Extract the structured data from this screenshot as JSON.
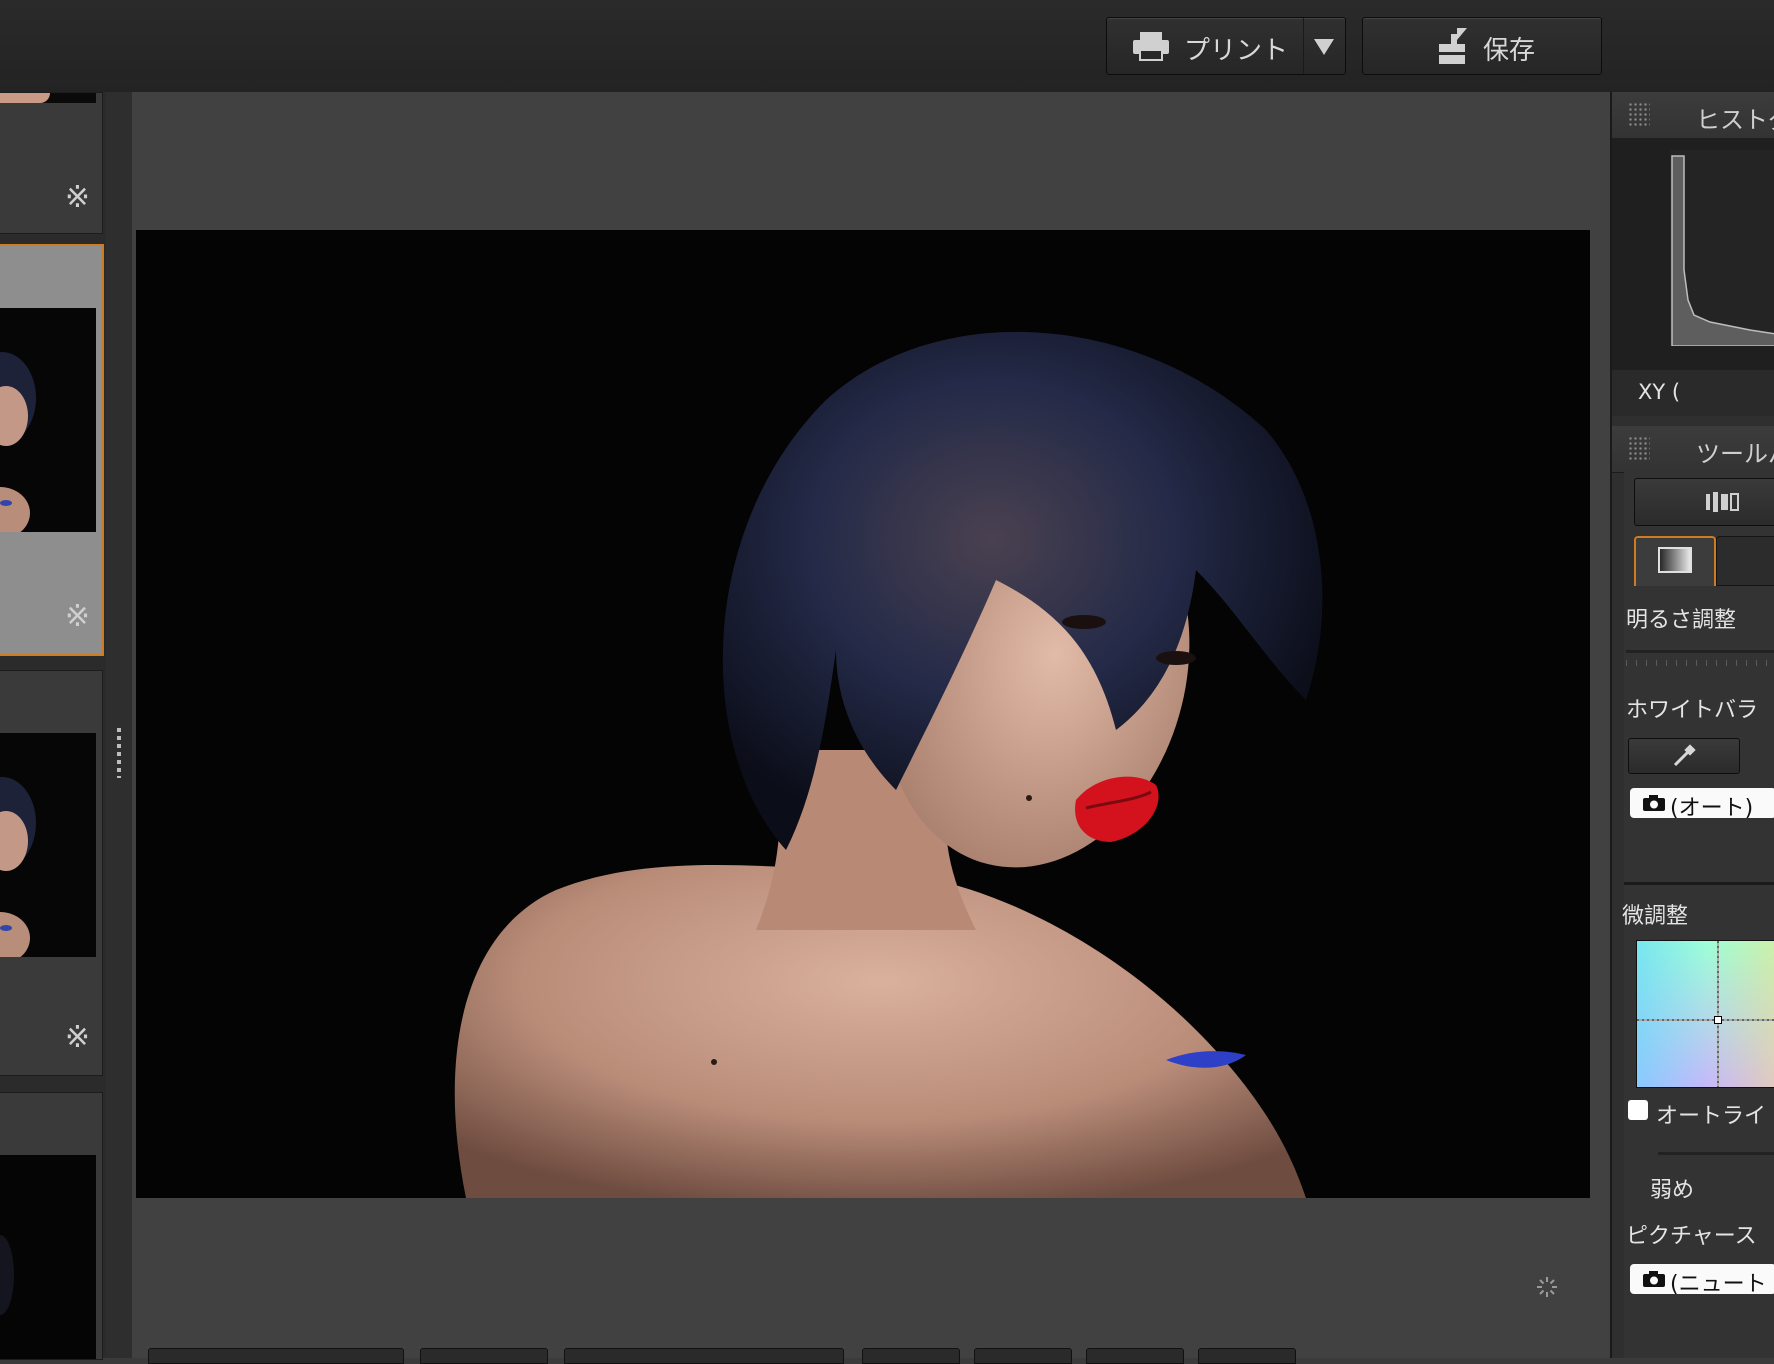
{
  "toolbar": {
    "print_label": "プリント",
    "save_label": "保存"
  },
  "histogram": {
    "title": "ヒストグ",
    "xy_label": "XY ("
  },
  "toolpalette": {
    "title": "ツールパ",
    "brightness_label": "明るさ調整",
    "white_balance_label": "ホワイトバラ",
    "wb_value": "(オート)",
    "fine_adjust_label": "微調整",
    "auto_lighting_label": "オートライ",
    "weak_label": "弱め",
    "picture_style_label": "ピクチャース",
    "picture_style_value": "(ニュート"
  },
  "filmstrip": {
    "marker": "※"
  }
}
